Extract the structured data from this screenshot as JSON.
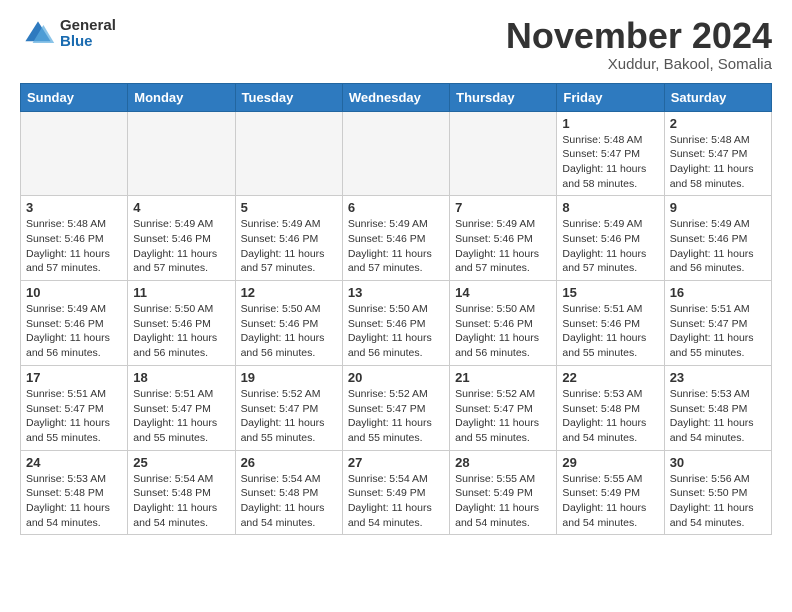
{
  "header": {
    "logo_general": "General",
    "logo_blue": "Blue",
    "month_title": "November 2024",
    "location": "Xuddur, Bakool, Somalia"
  },
  "weekdays": [
    "Sunday",
    "Monday",
    "Tuesday",
    "Wednesday",
    "Thursday",
    "Friday",
    "Saturday"
  ],
  "weeks": [
    [
      {
        "day": "",
        "empty": true
      },
      {
        "day": "",
        "empty": true
      },
      {
        "day": "",
        "empty": true
      },
      {
        "day": "",
        "empty": true
      },
      {
        "day": "",
        "empty": true
      },
      {
        "day": "1",
        "sunrise": "Sunrise: 5:48 AM",
        "sunset": "Sunset: 5:47 PM",
        "daylight": "Daylight: 11 hours and 58 minutes."
      },
      {
        "day": "2",
        "sunrise": "Sunrise: 5:48 AM",
        "sunset": "Sunset: 5:47 PM",
        "daylight": "Daylight: 11 hours and 58 minutes."
      }
    ],
    [
      {
        "day": "3",
        "sunrise": "Sunrise: 5:48 AM",
        "sunset": "Sunset: 5:46 PM",
        "daylight": "Daylight: 11 hours and 57 minutes."
      },
      {
        "day": "4",
        "sunrise": "Sunrise: 5:49 AM",
        "sunset": "Sunset: 5:46 PM",
        "daylight": "Daylight: 11 hours and 57 minutes."
      },
      {
        "day": "5",
        "sunrise": "Sunrise: 5:49 AM",
        "sunset": "Sunset: 5:46 PM",
        "daylight": "Daylight: 11 hours and 57 minutes."
      },
      {
        "day": "6",
        "sunrise": "Sunrise: 5:49 AM",
        "sunset": "Sunset: 5:46 PM",
        "daylight": "Daylight: 11 hours and 57 minutes."
      },
      {
        "day": "7",
        "sunrise": "Sunrise: 5:49 AM",
        "sunset": "Sunset: 5:46 PM",
        "daylight": "Daylight: 11 hours and 57 minutes."
      },
      {
        "day": "8",
        "sunrise": "Sunrise: 5:49 AM",
        "sunset": "Sunset: 5:46 PM",
        "daylight": "Daylight: 11 hours and 57 minutes."
      },
      {
        "day": "9",
        "sunrise": "Sunrise: 5:49 AM",
        "sunset": "Sunset: 5:46 PM",
        "daylight": "Daylight: 11 hours and 56 minutes."
      }
    ],
    [
      {
        "day": "10",
        "sunrise": "Sunrise: 5:49 AM",
        "sunset": "Sunset: 5:46 PM",
        "daylight": "Daylight: 11 hours and 56 minutes."
      },
      {
        "day": "11",
        "sunrise": "Sunrise: 5:50 AM",
        "sunset": "Sunset: 5:46 PM",
        "daylight": "Daylight: 11 hours and 56 minutes."
      },
      {
        "day": "12",
        "sunrise": "Sunrise: 5:50 AM",
        "sunset": "Sunset: 5:46 PM",
        "daylight": "Daylight: 11 hours and 56 minutes."
      },
      {
        "day": "13",
        "sunrise": "Sunrise: 5:50 AM",
        "sunset": "Sunset: 5:46 PM",
        "daylight": "Daylight: 11 hours and 56 minutes."
      },
      {
        "day": "14",
        "sunrise": "Sunrise: 5:50 AM",
        "sunset": "Sunset: 5:46 PM",
        "daylight": "Daylight: 11 hours and 56 minutes."
      },
      {
        "day": "15",
        "sunrise": "Sunrise: 5:51 AM",
        "sunset": "Sunset: 5:46 PM",
        "daylight": "Daylight: 11 hours and 55 minutes."
      },
      {
        "day": "16",
        "sunrise": "Sunrise: 5:51 AM",
        "sunset": "Sunset: 5:47 PM",
        "daylight": "Daylight: 11 hours and 55 minutes."
      }
    ],
    [
      {
        "day": "17",
        "sunrise": "Sunrise: 5:51 AM",
        "sunset": "Sunset: 5:47 PM",
        "daylight": "Daylight: 11 hours and 55 minutes."
      },
      {
        "day": "18",
        "sunrise": "Sunrise: 5:51 AM",
        "sunset": "Sunset: 5:47 PM",
        "daylight": "Daylight: 11 hours and 55 minutes."
      },
      {
        "day": "19",
        "sunrise": "Sunrise: 5:52 AM",
        "sunset": "Sunset: 5:47 PM",
        "daylight": "Daylight: 11 hours and 55 minutes."
      },
      {
        "day": "20",
        "sunrise": "Sunrise: 5:52 AM",
        "sunset": "Sunset: 5:47 PM",
        "daylight": "Daylight: 11 hours and 55 minutes."
      },
      {
        "day": "21",
        "sunrise": "Sunrise: 5:52 AM",
        "sunset": "Sunset: 5:47 PM",
        "daylight": "Daylight: 11 hours and 55 minutes."
      },
      {
        "day": "22",
        "sunrise": "Sunrise: 5:53 AM",
        "sunset": "Sunset: 5:48 PM",
        "daylight": "Daylight: 11 hours and 54 minutes."
      },
      {
        "day": "23",
        "sunrise": "Sunrise: 5:53 AM",
        "sunset": "Sunset: 5:48 PM",
        "daylight": "Daylight: 11 hours and 54 minutes."
      }
    ],
    [
      {
        "day": "24",
        "sunrise": "Sunrise: 5:53 AM",
        "sunset": "Sunset: 5:48 PM",
        "daylight": "Daylight: 11 hours and 54 minutes."
      },
      {
        "day": "25",
        "sunrise": "Sunrise: 5:54 AM",
        "sunset": "Sunset: 5:48 PM",
        "daylight": "Daylight: 11 hours and 54 minutes."
      },
      {
        "day": "26",
        "sunrise": "Sunrise: 5:54 AM",
        "sunset": "Sunset: 5:48 PM",
        "daylight": "Daylight: 11 hours and 54 minutes."
      },
      {
        "day": "27",
        "sunrise": "Sunrise: 5:54 AM",
        "sunset": "Sunset: 5:49 PM",
        "daylight": "Daylight: 11 hours and 54 minutes."
      },
      {
        "day": "28",
        "sunrise": "Sunrise: 5:55 AM",
        "sunset": "Sunset: 5:49 PM",
        "daylight": "Daylight: 11 hours and 54 minutes."
      },
      {
        "day": "29",
        "sunrise": "Sunrise: 5:55 AM",
        "sunset": "Sunset: 5:49 PM",
        "daylight": "Daylight: 11 hours and 54 minutes."
      },
      {
        "day": "30",
        "sunrise": "Sunrise: 5:56 AM",
        "sunset": "Sunset: 5:50 PM",
        "daylight": "Daylight: 11 hours and 54 minutes."
      }
    ]
  ]
}
